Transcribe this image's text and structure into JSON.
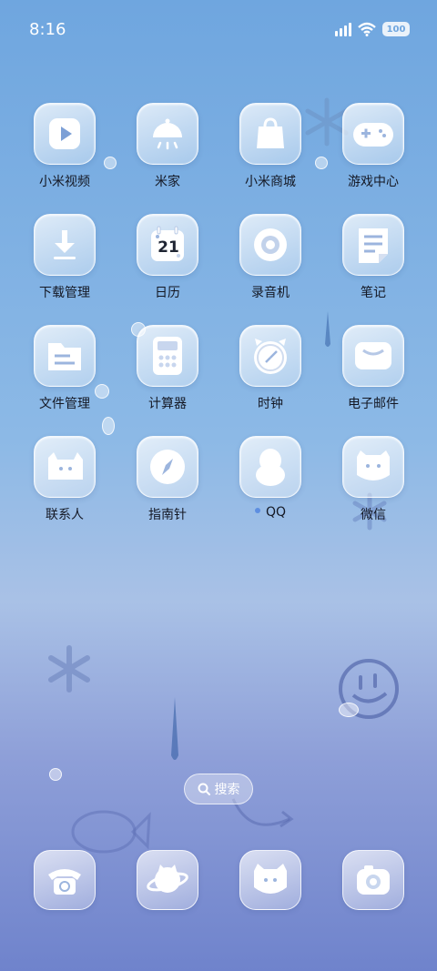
{
  "status_bar": {
    "time": "8:16",
    "battery": "100"
  },
  "apps": [
    {
      "label": "小米视频",
      "icon": "video-play-icon"
    },
    {
      "label": "米家",
      "icon": "smart-home-icon"
    },
    {
      "label": "小米商城",
      "icon": "shopping-bag-icon"
    },
    {
      "label": "游戏中心",
      "icon": "gamepad-icon"
    },
    {
      "label": "下载管理",
      "icon": "download-icon"
    },
    {
      "label": "日历",
      "icon": "calendar-icon",
      "date": "21"
    },
    {
      "label": "录音机",
      "icon": "recorder-icon"
    },
    {
      "label": "笔记",
      "icon": "notes-icon"
    },
    {
      "label": "文件管理",
      "icon": "folder-icon"
    },
    {
      "label": "计算器",
      "icon": "calculator-icon"
    },
    {
      "label": "时钟",
      "icon": "clock-icon"
    },
    {
      "label": "电子邮件",
      "icon": "mail-icon"
    },
    {
      "label": "联系人",
      "icon": "contacts-icon"
    },
    {
      "label": "指南针",
      "icon": "compass-icon"
    },
    {
      "label": "QQ",
      "icon": "qq-penguin-icon",
      "badge_dot": true
    },
    {
      "label": "微信",
      "icon": "wechat-cat-icon"
    }
  ],
  "search": {
    "label": "搜索"
  },
  "dock": [
    {
      "icon": "phone-icon"
    },
    {
      "icon": "browser-planet-icon"
    },
    {
      "icon": "messages-cat-icon"
    },
    {
      "icon": "camera-icon"
    }
  ]
}
